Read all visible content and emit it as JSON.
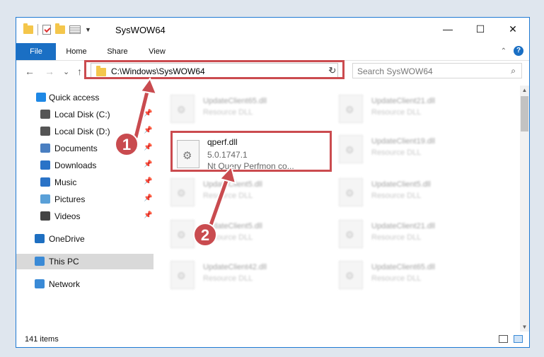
{
  "window": {
    "title": "SysWOW64"
  },
  "ribbon": {
    "tabs": [
      "File",
      "Home",
      "Share",
      "View"
    ],
    "help": "?"
  },
  "window_controls": {
    "minimize": "—",
    "maximize": "☐",
    "close": "✕"
  },
  "nav": {
    "back": "←",
    "forward": "→",
    "recent": "⌄",
    "up": "↑",
    "address": "C:\\Windows\\SysWOW64",
    "address_dropdown": "⌄",
    "refresh": "↻",
    "search_placeholder": "Search SysWOW64",
    "search_icon": "⌕"
  },
  "sidebar": {
    "items": [
      {
        "label": "Quick access",
        "icon": "star-icon",
        "color": "#1e88e5"
      },
      {
        "label": "Local Disk (C:)",
        "icon": "drive-icon",
        "color": "#555555",
        "pinned": true
      },
      {
        "label": "Local Disk (D:)",
        "icon": "drive-icon",
        "color": "#555555",
        "pinned": true
      },
      {
        "label": "Documents",
        "icon": "documents-icon",
        "color": "#4a7fc1",
        "pinned": true
      },
      {
        "label": "Downloads",
        "icon": "downloads-icon",
        "color": "#2a73c7",
        "pinned": true
      },
      {
        "label": "Music",
        "icon": "music-icon",
        "color": "#2a73c7",
        "pinned": true
      },
      {
        "label": "Pictures",
        "icon": "pictures-icon",
        "color": "#5aa0d8",
        "pinned": true
      },
      {
        "label": "Videos",
        "icon": "videos-icon",
        "color": "#444444",
        "pinned": true
      },
      {
        "label": "OneDrive",
        "icon": "cloud-icon",
        "color": "#1e6fc1"
      },
      {
        "label": "This PC",
        "icon": "computer-icon",
        "color": "#3a8ad6",
        "selected": true
      },
      {
        "label": "Network",
        "icon": "network-icon",
        "color": "#3a8ad6"
      }
    ],
    "pin_glyph": "📌"
  },
  "files": [
    {
      "name": "UpdateClient65.dll",
      "desc": "Resource DLL"
    },
    {
      "name": "UpdateClient21.dll",
      "desc": "Resource DLL"
    },
    {
      "name": "UpdateClient19.dll",
      "desc": "Resource DLL"
    },
    {
      "name": "UpdateClient5.dll",
      "desc": "Resource DLL"
    },
    {
      "name": "UpdateClient5.dll",
      "desc": "Resource DLL"
    },
    {
      "name": "UpdateClient5.dll",
      "desc": "Resource DLL"
    },
    {
      "name": "UpdateClient21.dll",
      "desc": "Resource DLL"
    },
    {
      "name": "UpdateClient42.dll",
      "desc": "Resource DLL"
    },
    {
      "name": "UpdateClient65.dll",
      "desc": "Resource DLL"
    }
  ],
  "highlighted_file": {
    "name": "qperf.dll",
    "version": "5.0.1747.1",
    "desc": "Nt Query Perfmon co..."
  },
  "status": {
    "count": "141 items"
  },
  "steps": [
    "1",
    "2"
  ],
  "colors": {
    "accent": "#1a6fc4",
    "highlight": "#cb4b4f"
  }
}
